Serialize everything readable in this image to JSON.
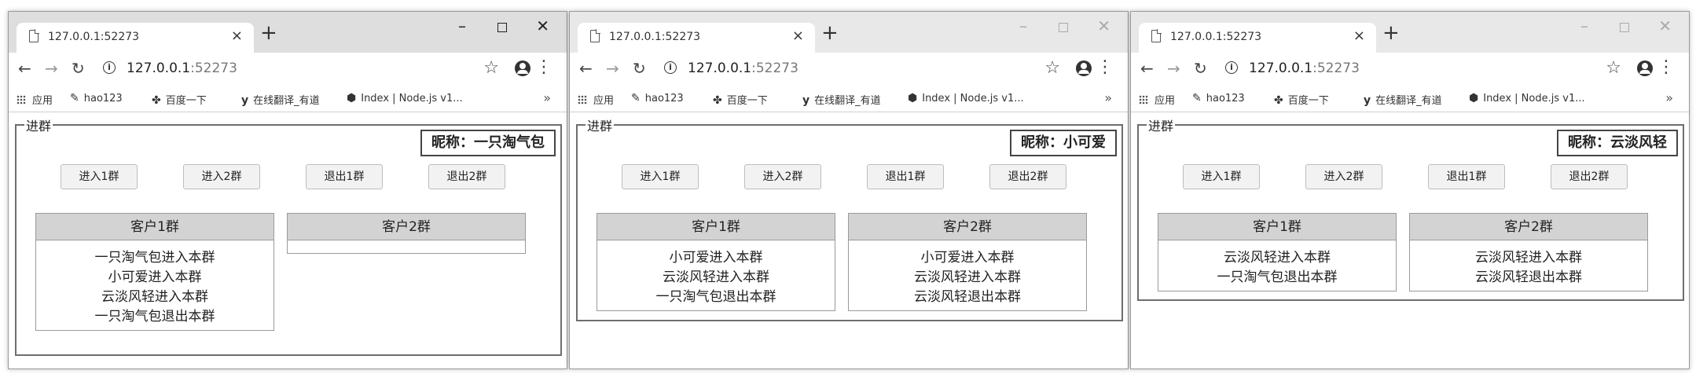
{
  "windows": [
    {
      "tab_title": "127.0.0.1:52273",
      "url_host": "127.0.0.1",
      "url_port": ":52273",
      "bookmarks": [
        "应用",
        "hao123",
        "百度一下",
        "在线翻译_有道",
        "Index | Node.js v1...",
        "»"
      ],
      "fieldset_legend": "进群",
      "nickname": "昵称：一只淘气包",
      "buttons": [
        "进入1群",
        "进入2群",
        "退出1群",
        "退出2群"
      ],
      "group1": {
        "title": "客户1群",
        "messages": [
          "一只淘气包进入本群",
          "小可爱进入本群",
          "云淡风轻进入本群",
          "一只淘气包退出本群"
        ]
      },
      "group2": {
        "title": "客户2群",
        "messages": []
      }
    },
    {
      "tab_title": "127.0.0.1:52273",
      "url_host": "127.0.0.1",
      "url_port": ":52273",
      "bookmarks": [
        "应用",
        "hao123",
        "百度一下",
        "在线翻译_有道",
        "Index | Node.js v1...",
        "»"
      ],
      "fieldset_legend": "进群",
      "nickname": "昵称：小可爱",
      "buttons": [
        "进入1群",
        "进入2群",
        "退出1群",
        "退出2群"
      ],
      "group1": {
        "title": "客户1群",
        "messages": [
          "小可爱进入本群",
          "云淡风轻进入本群",
          "一只淘气包退出本群"
        ]
      },
      "group2": {
        "title": "客户2群",
        "messages": [
          "小可爱进入本群",
          "云淡风轻进入本群",
          "云淡风轻退出本群"
        ]
      }
    },
    {
      "tab_title": "127.0.0.1:52273",
      "url_host": "127.0.0.1",
      "url_port": ":52273",
      "bookmarks": [
        "应用",
        "hao123",
        "百度一下",
        "在线翻译_有道",
        "Index | Node.js v1...",
        "»"
      ],
      "fieldset_legend": "进群",
      "nickname": "昵称：云淡风轻",
      "buttons": [
        "进入1群",
        "进入2群",
        "退出1群",
        "退出2群"
      ],
      "group1": {
        "title": "客户1群",
        "messages": [
          "云淡风轻进入本群",
          "一只淘气包退出本群"
        ]
      },
      "group2": {
        "title": "客户2群",
        "messages": [
          "云淡风轻进入本群",
          "云淡风轻退出本群"
        ]
      }
    }
  ]
}
